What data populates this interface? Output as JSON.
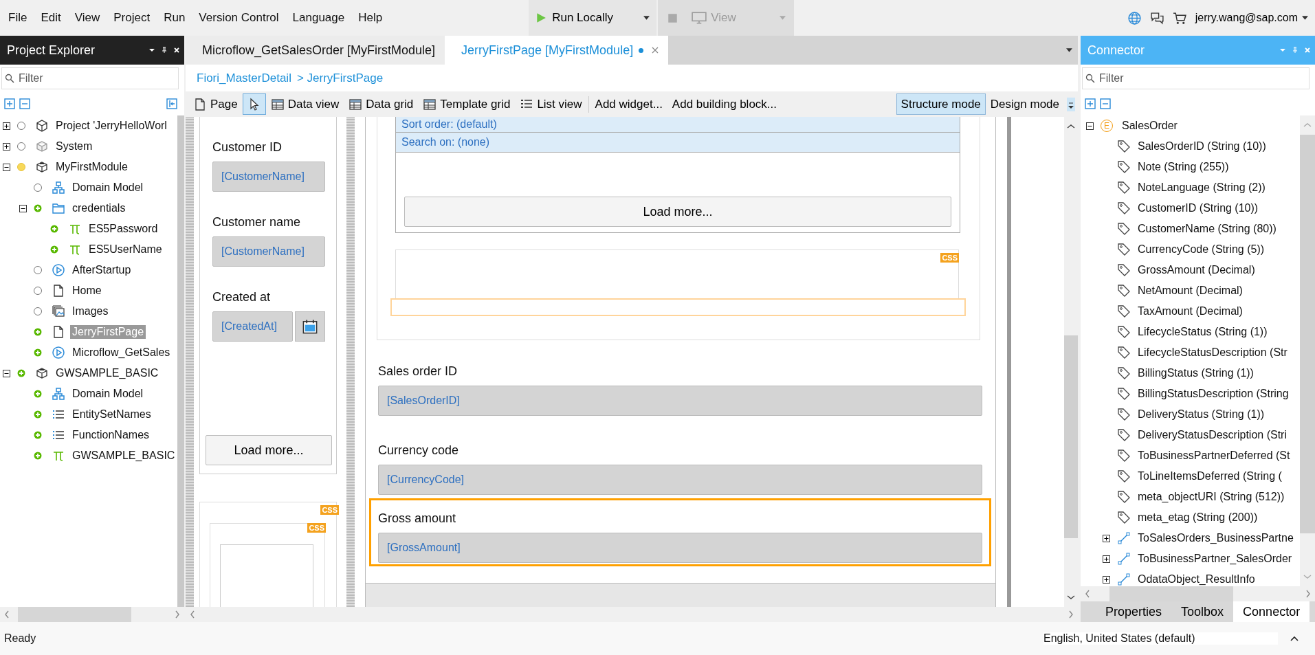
{
  "menu": [
    "File",
    "Edit",
    "View",
    "Project",
    "Run",
    "Version Control",
    "Language",
    "Help"
  ],
  "run_button": {
    "label": "Run Locally"
  },
  "view_button": {
    "label": "View",
    "disabled": true
  },
  "account": {
    "user": "jerry.wang@sap.com"
  },
  "project_explorer": {
    "title": "Project Explorer",
    "filter": {
      "placeholder": "Filter"
    },
    "tree": [
      {
        "label": "Project 'JerryHelloWorl",
        "kind": "project",
        "added": false,
        "modified": false,
        "selected": false,
        "expanded": false
      },
      {
        "label": "System",
        "kind": "system",
        "added": false,
        "modified": false,
        "selected": false,
        "expanded": false
      },
      {
        "label": "MyFirstModule",
        "kind": "module",
        "added": false,
        "modified": true,
        "selected": false,
        "expanded": true,
        "children": [
          {
            "label": "Domain Model",
            "kind": "domain",
            "added": false,
            "modified": false,
            "selected": false
          },
          {
            "label": "credentials",
            "kind": "folder",
            "added": true,
            "modified": false,
            "selected": false,
            "expanded": true,
            "children": [
              {
                "label": "ES5Password",
                "kind": "constant",
                "added": true,
                "modified": false,
                "selected": false
              },
              {
                "label": "ES5UserName",
                "kind": "constant",
                "added": true,
                "modified": false,
                "selected": false
              }
            ]
          },
          {
            "label": "AfterStartup",
            "kind": "microflow",
            "added": false,
            "modified": false,
            "selected": false
          },
          {
            "label": "Home",
            "kind": "page",
            "added": false,
            "modified": false,
            "selected": false
          },
          {
            "label": "Images",
            "kind": "images",
            "added": false,
            "modified": false,
            "selected": false
          },
          {
            "label": "JerryFirstPage",
            "kind": "page",
            "added": true,
            "modified": false,
            "selected": true
          },
          {
            "label": "Microflow_GetSales",
            "kind": "microflow",
            "added": true,
            "modified": false,
            "selected": false
          }
        ]
      },
      {
        "label": "GWSAMPLE_BASIC",
        "kind": "module",
        "added": true,
        "modified": false,
        "selected": false,
        "expanded": true,
        "children": [
          {
            "label": "Domain Model",
            "kind": "domain",
            "added": true,
            "modified": false,
            "selected": false
          },
          {
            "label": "EntitySetNames",
            "kind": "enumeration",
            "added": true,
            "modified": false,
            "selected": false
          },
          {
            "label": "FunctionNames",
            "kind": "enumeration",
            "added": true,
            "modified": false,
            "selected": false
          },
          {
            "label": "GWSAMPLE_BASIC",
            "kind": "constant",
            "added": true,
            "modified": false,
            "selected": false
          }
        ]
      }
    ]
  },
  "editor": {
    "tabs": [
      {
        "label": "Microflow_GetSalesOrder [MyFirstModule]",
        "selected": false,
        "modified": false
      },
      {
        "label": "JerryFirstPage [MyFirstModule]",
        "selected": true,
        "modified": true
      }
    ],
    "breadcrumb": [
      "Fiori_MasterDetail",
      "> JerryFirstPage"
    ],
    "toolbar": [
      {
        "kind": "page",
        "label": "Page",
        "selected": false
      },
      {
        "kind": "pointer",
        "selected": true
      },
      {
        "kind": "dataview",
        "label": "Data view",
        "selected": false
      },
      {
        "kind": "datagrid",
        "label": "Data grid",
        "selected": false
      },
      {
        "kind": "templategrid",
        "label": "Template grid",
        "selected": false
      },
      {
        "kind": "listview",
        "label": "List view",
        "selected": false
      },
      {
        "kind": "text",
        "label": "Add widget...",
        "selected": false
      },
      {
        "kind": "text",
        "label": "Add building block...",
        "selected": false
      }
    ],
    "modes": [
      {
        "label": "Structure mode",
        "selected": true
      },
      {
        "label": "Design mode",
        "selected": false
      }
    ],
    "canvas": {
      "side_column": {
        "fields": [
          {
            "label": "Customer ID",
            "value": "[CustomerName]",
            "kind": "text"
          },
          {
            "label": "Customer name",
            "value": "[CustomerName]",
            "kind": "text"
          },
          {
            "label": "Created at",
            "value": "[CreatedAt]",
            "kind": "date"
          }
        ],
        "button": "Load more...",
        "badges": [
          "CSS",
          "CSS"
        ]
      },
      "list_view": {
        "rows": [
          "Sort order: (default)",
          "Search on: (none)"
        ],
        "button": "Load more...",
        "badge": "CSS"
      },
      "fields": [
        {
          "label": "Sales order ID",
          "value": "[SalesOrderID]",
          "selected": false
        },
        {
          "label": "Currency code",
          "value": "[CurrencyCode]",
          "selected": false
        },
        {
          "label": "Gross amount",
          "value": "[GrossAmount]",
          "selected": true
        }
      ]
    }
  },
  "connector": {
    "title": "Connector",
    "filter": {
      "placeholder": "Filter"
    },
    "tree": [
      {
        "label": "SalesOrder",
        "kind": "entity",
        "letter": "E",
        "expanded": true,
        "children": [
          {
            "label": "SalesOrderID (String (10))",
            "kind": "attribute"
          },
          {
            "label": "Note (String (255))",
            "kind": "attribute"
          },
          {
            "label": "NoteLanguage (String (2))",
            "kind": "attribute"
          },
          {
            "label": "CustomerID (String (10))",
            "kind": "attribute"
          },
          {
            "label": "CustomerName (String (80))",
            "kind": "attribute"
          },
          {
            "label": "CurrencyCode (String (5))",
            "kind": "attribute"
          },
          {
            "label": "GrossAmount (Decimal)",
            "kind": "attribute"
          },
          {
            "label": "NetAmount (Decimal)",
            "kind": "attribute"
          },
          {
            "label": "TaxAmount (Decimal)",
            "kind": "attribute"
          },
          {
            "label": "LifecycleStatus (String (1))",
            "kind": "attribute"
          },
          {
            "label": "LifecycleStatusDescription (Str",
            "kind": "attribute"
          },
          {
            "label": "BillingStatus (String (1))",
            "kind": "attribute"
          },
          {
            "label": "BillingStatusDescription (String",
            "kind": "attribute"
          },
          {
            "label": "DeliveryStatus (String (1))",
            "kind": "attribute"
          },
          {
            "label": "DeliveryStatusDescription (Stri",
            "kind": "attribute"
          },
          {
            "label": "ToBusinessPartnerDeferred (St",
            "kind": "attribute"
          },
          {
            "label": "ToLineItemsDeferred (String (",
            "kind": "attribute"
          },
          {
            "label": "meta_objectURI (String (512))",
            "kind": "attribute"
          },
          {
            "label": "meta_etag (String (200))",
            "kind": "attribute"
          },
          {
            "label": "ToSalesOrders_BusinessPartne",
            "kind": "association",
            "expanded": false
          },
          {
            "label": "ToBusinessPartner_SalesOrder",
            "kind": "association",
            "expanded": false
          },
          {
            "label": "OdataObject_ResultInfo",
            "kind": "association",
            "expanded": false
          }
        ]
      }
    ]
  },
  "bottom_tabs": [
    {
      "label": "Properties",
      "selected": false
    },
    {
      "label": "Toolbox",
      "selected": false
    },
    {
      "label": "Connector",
      "selected": true
    }
  ],
  "status_bar": {
    "left": "Ready",
    "right": "English, United States (default)"
  }
}
